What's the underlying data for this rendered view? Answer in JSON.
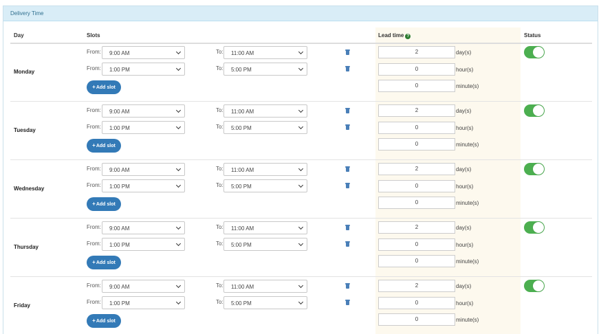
{
  "panel": {
    "title": "Delivery Time"
  },
  "header": {
    "day": "Day",
    "slots": "Slots",
    "lead_time": "Lead time",
    "status": "Status"
  },
  "labels": {
    "from": "From:",
    "to": "To:",
    "add_slot": "Add slot",
    "days_unit": "day(s)",
    "hours_unit": "hour(s)",
    "minutes_unit": "minute(s)"
  },
  "colors": {
    "toggle_on": "#4caf50",
    "button": "#337ab7",
    "heading_bg": "#d9edf7",
    "lead_bg": "#fdf9ee"
  },
  "rows": [
    {
      "day": "Monday",
      "slots": [
        {
          "from": "9:00 AM",
          "to": "11:00 AM"
        },
        {
          "from": "1:00 PM",
          "to": "5:00 PM"
        }
      ],
      "lead": {
        "days": "2",
        "hours": "0",
        "minutes": "0"
      },
      "status_on": true
    },
    {
      "day": "Tuesday",
      "slots": [
        {
          "from": "9:00 AM",
          "to": "11:00 AM"
        },
        {
          "from": "1:00 PM",
          "to": "5:00 PM"
        }
      ],
      "lead": {
        "days": "2",
        "hours": "0",
        "minutes": "0"
      },
      "status_on": true
    },
    {
      "day": "Wednesday",
      "slots": [
        {
          "from": "9:00 AM",
          "to": "11:00 AM"
        },
        {
          "from": "1:00 PM",
          "to": "5:00 PM"
        }
      ],
      "lead": {
        "days": "2",
        "hours": "0",
        "minutes": "0"
      },
      "status_on": true
    },
    {
      "day": "Thursday",
      "slots": [
        {
          "from": "9:00 AM",
          "to": "11:00 AM"
        },
        {
          "from": "1:00 PM",
          "to": "5:00 PM"
        }
      ],
      "lead": {
        "days": "2",
        "hours": "0",
        "minutes": "0"
      },
      "status_on": true
    },
    {
      "day": "Friday",
      "slots": [
        {
          "from": "9:00 AM",
          "to": "11:00 AM"
        },
        {
          "from": "1:00 PM",
          "to": "5:00 PM"
        }
      ],
      "lead": {
        "days": "2",
        "hours": "0",
        "minutes": "0"
      },
      "status_on": true
    }
  ]
}
